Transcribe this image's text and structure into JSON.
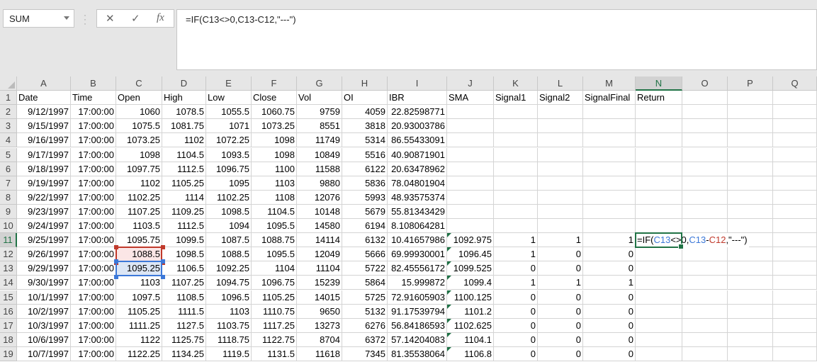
{
  "name_box": "SUM",
  "formula_bar": {
    "cancel_icon": "✕",
    "enter_icon": "✓",
    "fx_label": "fx",
    "formula": "=IF(C13<>0,C13-C12,\"---\")"
  },
  "active_cell": {
    "ref": "N11",
    "parts": [
      {
        "t": "=IF(",
        "c": ""
      },
      {
        "t": "C13",
        "c": "blue"
      },
      {
        "t": "<>0,",
        "c": ""
      },
      {
        "t": "C13",
        "c": "blue"
      },
      {
        "t": "-",
        "c": ""
      },
      {
        "t": "C12",
        "c": "red"
      },
      {
        "t": ",\"---\")",
        "c": ""
      }
    ]
  },
  "columns": [
    "A",
    "B",
    "C",
    "D",
    "E",
    "F",
    "G",
    "H",
    "I",
    "J",
    "K",
    "L",
    "M",
    "N",
    "O",
    "P",
    "Q"
  ],
  "headers": [
    "Date",
    "Time",
    "Open",
    "High",
    "Low",
    "Close",
    "Vol",
    "OI",
    "IBR",
    "SMA",
    "Signal1",
    "Signal2",
    "SignalFinal",
    "Return"
  ],
  "rows": [
    [
      "9/12/1997",
      "17:00:00",
      "1060",
      "1078.5",
      "1055.5",
      "1060.75",
      "9759",
      "4059",
      "22.82598771",
      "",
      "",
      "",
      ""
    ],
    [
      "9/15/1997",
      "17:00:00",
      "1075.5",
      "1081.75",
      "1071",
      "1073.25",
      "8551",
      "3818",
      "20.93003786",
      "",
      "",
      "",
      ""
    ],
    [
      "9/16/1997",
      "17:00:00",
      "1073.25",
      "1102",
      "1072.25",
      "1098",
      "11749",
      "5314",
      "86.55433091",
      "",
      "",
      "",
      ""
    ],
    [
      "9/17/1997",
      "17:00:00",
      "1098",
      "1104.5",
      "1093.5",
      "1098",
      "10849",
      "5516",
      "40.90871901",
      "",
      "",
      "",
      ""
    ],
    [
      "9/18/1997",
      "17:00:00",
      "1097.75",
      "1112.5",
      "1096.75",
      "1100",
      "11588",
      "6122",
      "20.63478962",
      "",
      "",
      "",
      ""
    ],
    [
      "9/19/1997",
      "17:00:00",
      "1102",
      "1105.25",
      "1095",
      "1103",
      "9880",
      "5836",
      "78.04801904",
      "",
      "",
      "",
      ""
    ],
    [
      "9/22/1997",
      "17:00:00",
      "1102.25",
      "1114",
      "1102.25",
      "1108",
      "12076",
      "5993",
      "48.93575374",
      "",
      "",
      "",
      ""
    ],
    [
      "9/23/1997",
      "17:00:00",
      "1107.25",
      "1109.25",
      "1098.5",
      "1104.5",
      "10148",
      "5679",
      "55.81343429",
      "",
      "",
      "",
      ""
    ],
    [
      "9/24/1997",
      "17:00:00",
      "1103.5",
      "1112.5",
      "1094",
      "1095.5",
      "14580",
      "6194",
      "8.108064281",
      "",
      "",
      "",
      ""
    ],
    [
      "9/25/1997",
      "17:00:00",
      "1095.75",
      "1099.5",
      "1087.5",
      "1088.75",
      "14114",
      "6132",
      "10.41657986",
      "1092.975",
      "1",
      "1",
      "1"
    ],
    [
      "9/26/1997",
      "17:00:00",
      "1088.5",
      "1098.5",
      "1088.5",
      "1095.5",
      "12049",
      "5666",
      "69.99930001",
      "1096.45",
      "1",
      "0",
      "0"
    ],
    [
      "9/29/1997",
      "17:00:00",
      "1095.25",
      "1106.5",
      "1092.25",
      "1104",
      "11104",
      "5722",
      "82.45556172",
      "1099.525",
      "0",
      "0",
      "0"
    ],
    [
      "9/30/1997",
      "17:00:00",
      "1103",
      "1107.25",
      "1094.75",
      "1096.75",
      "15239",
      "5864",
      "15.999872",
      "1099.4",
      "1",
      "1",
      "1"
    ],
    [
      "10/1/1997",
      "17:00:00",
      "1097.5",
      "1108.5",
      "1096.5",
      "1105.25",
      "14015",
      "5725",
      "72.91605903",
      "1100.125",
      "0",
      "0",
      "0"
    ],
    [
      "10/2/1997",
      "17:00:00",
      "1105.25",
      "1111.5",
      "1103",
      "1110.75",
      "9650",
      "5132",
      "91.17539794",
      "1101.2",
      "0",
      "0",
      "0"
    ],
    [
      "10/3/1997",
      "17:00:00",
      "1111.25",
      "1127.5",
      "1103.75",
      "1117.25",
      "13273",
      "6276",
      "56.84186593",
      "1102.625",
      "0",
      "0",
      "0"
    ],
    [
      "10/6/1997",
      "17:00:00",
      "1122",
      "1125.75",
      "1118.75",
      "1122.75",
      "8704",
      "6372",
      "57.14204083",
      "1104.1",
      "0",
      "0",
      "0"
    ],
    [
      "10/7/1997",
      "17:00:00",
      "1122.25",
      "1134.25",
      "1119.5",
      "1131.5",
      "11618",
      "7345",
      "81.35538064",
      "1106.8",
      "0",
      "0",
      "0"
    ]
  ]
}
